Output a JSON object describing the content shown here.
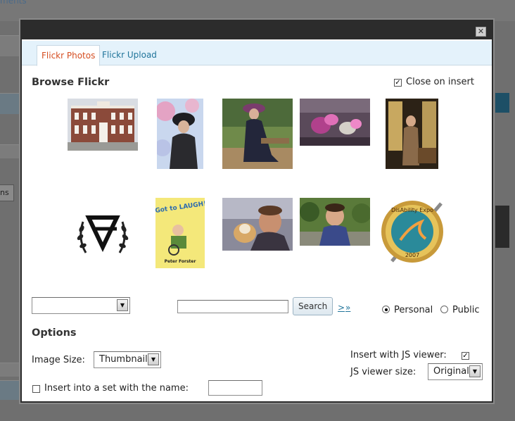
{
  "background": {
    "partial_link": "ments"
  },
  "modal": {
    "close_icon": "close-icon",
    "tabs": [
      {
        "label": "Flickr Photos",
        "active": true
      },
      {
        "label": "Flickr Upload",
        "active": false
      }
    ],
    "heading": "Browse Flickr",
    "close_on_insert_label": "Close on insert",
    "close_on_insert_checked": true,
    "search_button_label": "Search",
    "pager_next": ">",
    "pager_last": "»",
    "scope_options": [
      {
        "label": "Personal",
        "selected": true
      },
      {
        "label": "Public",
        "selected": false
      }
    ],
    "options_heading": "Options",
    "image_size_label": "Image Size:",
    "image_size_value": "Thumbnail",
    "insert_js_viewer_label": "Insert with JS viewer:",
    "insert_js_viewer_checked": true,
    "js_viewer_size_label": "JS viewer size:",
    "js_viewer_size_value": "Original",
    "insert_set_label": "Insert into a set with the name:",
    "insert_set_checked": false
  },
  "thumbnails_lettering": {
    "book_cover_title": "I Got to LAUGH!!",
    "book_cover_author": "Peter Forster",
    "expo_badge_top": "DisAbility Expo",
    "expo_badge_year": "2007"
  }
}
